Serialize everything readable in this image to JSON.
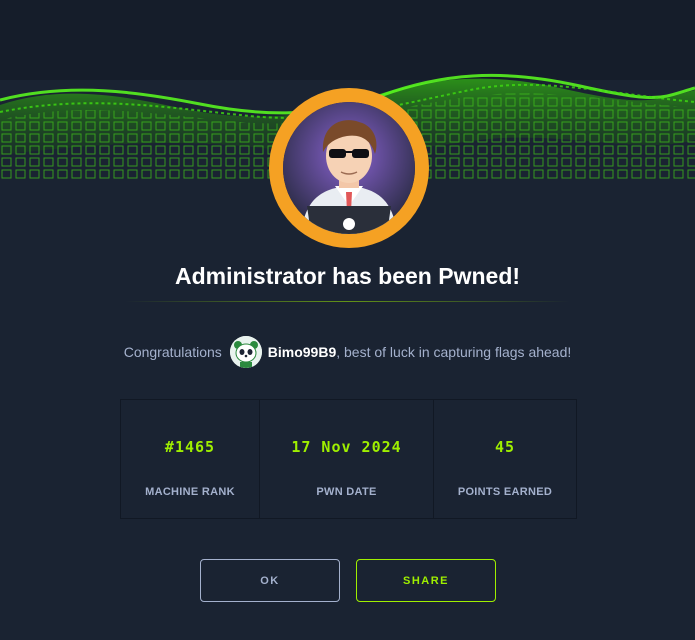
{
  "colors": {
    "background": "#1a2332",
    "accent": "#9fef00",
    "badge_ring": "#f5a123",
    "text_muted": "#a4b1cd",
    "text_primary": "#ffffff"
  },
  "banner": {
    "icon": "green-cube-wave-graphic"
  },
  "badge": {
    "icon": "administrator-avatar-icon"
  },
  "title": "Administrator has been Pwned!",
  "message": {
    "prefix": "Congratulations",
    "avatar_icon": "panda-avatar-icon",
    "username": "Bimo99B9",
    "suffix": ", best of luck in capturing flags ahead!"
  },
  "stats": [
    {
      "value": "#1465",
      "label": "MACHINE RANK"
    },
    {
      "value": "17 Nov 2024",
      "label": "PWN DATE"
    },
    {
      "value": "45",
      "label": "POINTS EARNED"
    }
  ],
  "buttons": {
    "ok": "OK",
    "share": "SHARE"
  }
}
